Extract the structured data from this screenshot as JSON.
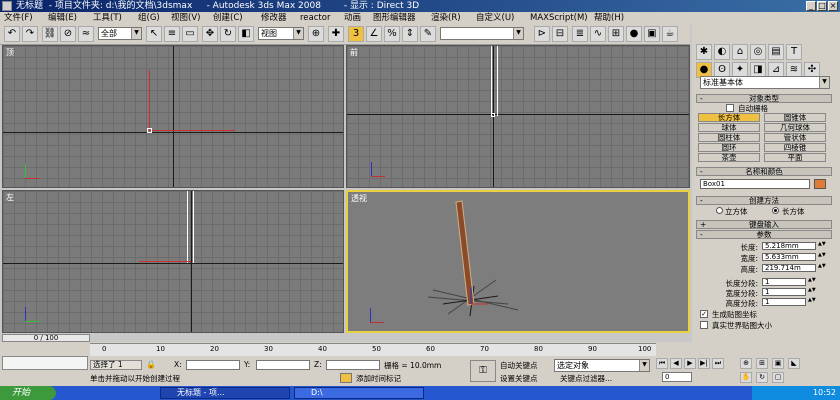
{
  "title_bar": {
    "title": "无标题  - 项目文件夹: d:\\我的文档\\3dsmax     - Autodesk 3ds Max 2008        - 显示 : Direct 3D"
  },
  "menu": {
    "items": [
      "文件(F)",
      "编辑(E)",
      "工具(T)",
      "组(G)",
      "视图(V)",
      "创建(C)",
      "修改器",
      "reactor",
      "动画",
      "图形编辑器",
      "渲染(R)",
      "自定义(U)",
      "MAXScript(M)",
      "帮助(H)"
    ]
  },
  "toolbar": {
    "filter_select": "全部",
    "ref_coord": "视图",
    "named_selection": "",
    "snap_view_select": "视图"
  },
  "viewports": {
    "top": "顶",
    "front": "前",
    "left": "左",
    "perspective": "透视"
  },
  "command_panel": {
    "category_select": "标准基本体",
    "object_type": {
      "header": "对象类型",
      "auto_grid": "自动栅格",
      "buttons": [
        "长方体",
        "圆锥体",
        "球体",
        "几何球体",
        "圆柱体",
        "管状体",
        "圆环",
        "四棱锥",
        "茶壶",
        "平面"
      ]
    },
    "name_color": {
      "header": "名称和颜色",
      "name": "Box01",
      "color": "#e07a38"
    },
    "creation_method": {
      "header": "创建方法",
      "opt_cube": "立方体",
      "opt_box": "长方体"
    },
    "keyboard_entry": {
      "header": "键盘输入"
    },
    "params": {
      "header": "参数",
      "length_label": "长度:",
      "length": "5.218mm",
      "width_label": "宽度:",
      "width": "5.633mm",
      "height_label": "高度:",
      "height": "219.714m",
      "length_segs_label": "长度分段:",
      "length_segs": "1",
      "width_segs_label": "宽度分段:",
      "width_segs": "1",
      "height_segs_label": "高度分段:",
      "height_segs": "1",
      "gen_map_coords": "生成贴图坐标",
      "real_world_map": "真实世界贴图大小"
    }
  },
  "timeline": {
    "frame": "0 / 100",
    "ticks": [
      "0",
      "10",
      "20",
      "30",
      "40",
      "50",
      "60",
      "70",
      "80",
      "90",
      "100"
    ]
  },
  "status": {
    "selection": "选择了 1",
    "x_label": "X:",
    "y_label": "Y:",
    "z_label": "Z:",
    "grid": "栅格 = 10.0mm",
    "prompt": "单击并拖动以开始创建过程",
    "add_time_tag": "添加时间标记",
    "auto_key": "自动关键点",
    "set_key": "设置关键点",
    "key_mode": "选定对象",
    "key_filters": "关键点过滤器...",
    "current_frame": "0"
  },
  "taskbar": {
    "start": "开始",
    "tasks": [
      "无标题 - 项...",
      "D:\\"
    ],
    "clock": "10:52"
  }
}
